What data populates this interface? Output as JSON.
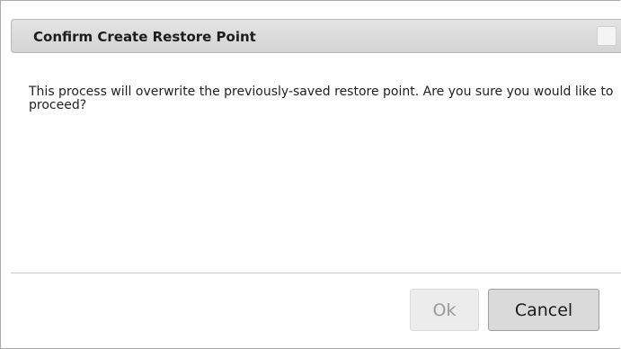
{
  "dialog": {
    "title": "Confirm Create Restore Point",
    "message": "This process will overwrite the previously-saved restore point. Are you sure you would like to proceed?",
    "buttons": {
      "ok_label": "Ok",
      "cancel_label": "Cancel"
    },
    "close_icon": "close-icon"
  }
}
